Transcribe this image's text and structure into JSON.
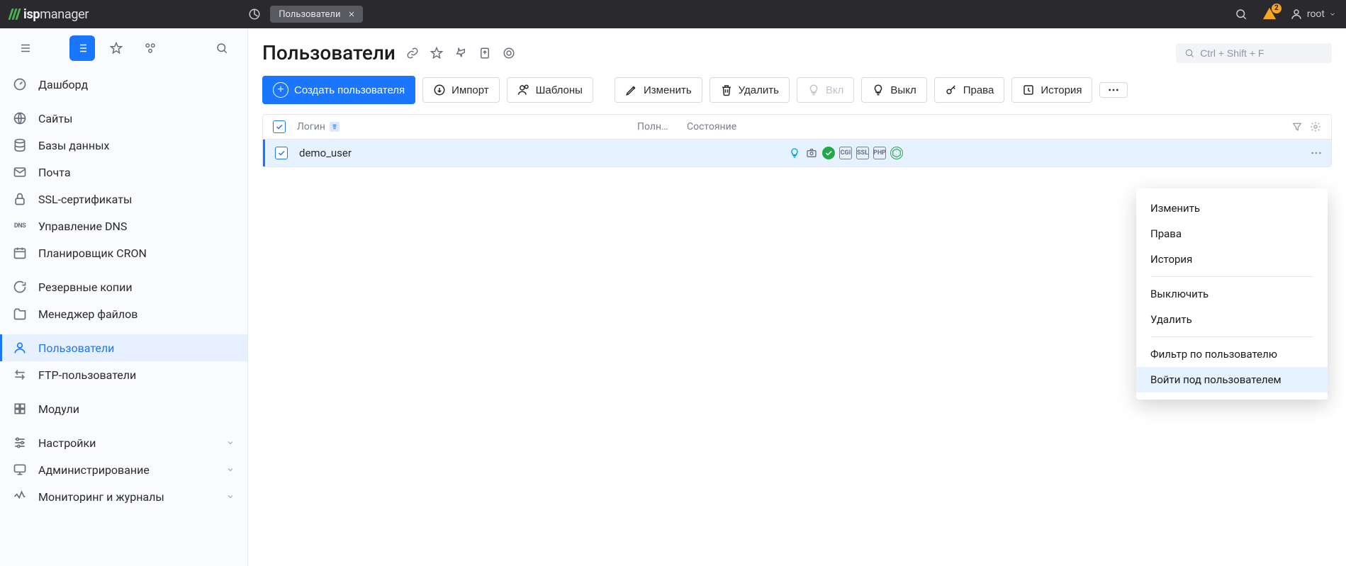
{
  "brand": {
    "name_bold": "isp",
    "name_rest": "manager"
  },
  "top_tabs": {
    "chart_icon": "chart",
    "active_tab": "Пользователи"
  },
  "topbar": {
    "notifications": "2",
    "username": "root"
  },
  "sidebar": {
    "items": [
      {
        "icon": "gauge",
        "label": "Дашборд"
      },
      {
        "icon": "globe",
        "label": "Сайты"
      },
      {
        "icon": "db",
        "label": "Базы данных"
      },
      {
        "icon": "mail",
        "label": "Почта"
      },
      {
        "icon": "lock",
        "label": "SSL-сертификаты"
      },
      {
        "icon": "dns",
        "label": "Управление DNS"
      },
      {
        "icon": "cal",
        "label": "Планировщик CRON"
      },
      {
        "icon": "backup",
        "label": "Резервные копии"
      },
      {
        "icon": "folder",
        "label": "Менеджер файлов"
      },
      {
        "icon": "user",
        "label": "Пользователи",
        "active": true
      },
      {
        "icon": "ftp",
        "label": "FTP-пользователи"
      },
      {
        "icon": "module",
        "label": "Модули"
      },
      {
        "icon": "sliders",
        "label": "Настройки",
        "expand": true
      },
      {
        "icon": "admin",
        "label": "Администрирование",
        "expand": true
      },
      {
        "icon": "monitor",
        "label": "Мониторинг и журналы",
        "expand": true
      }
    ]
  },
  "page": {
    "title": "Пользователи",
    "search_placeholder": "Ctrl + Shift + F"
  },
  "toolbar": {
    "create": "Создать пользователя",
    "import": "Импорт",
    "templates": "Шаблоны",
    "edit": "Изменить",
    "delete": "Удалить",
    "on": "Вкл",
    "off": "Выкл",
    "rights": "Права",
    "history": "История"
  },
  "table": {
    "head": {
      "login": "Логин",
      "fullname": "Полн…",
      "state": "Состояние"
    },
    "rows": [
      {
        "login": "demo_user",
        "state_badges": [
          "bulb",
          "camera",
          "check",
          "CGI",
          "SSL",
          "PHP",
          "node"
        ]
      }
    ]
  },
  "context_menu": {
    "items": [
      "Изменить",
      "Права",
      "История"
    ],
    "items2": [
      "Выключить",
      "Удалить"
    ],
    "items3": [
      "Фильтр по пользователю",
      "Войти под пользователем"
    ],
    "highlight": "Войти под пользователем"
  }
}
